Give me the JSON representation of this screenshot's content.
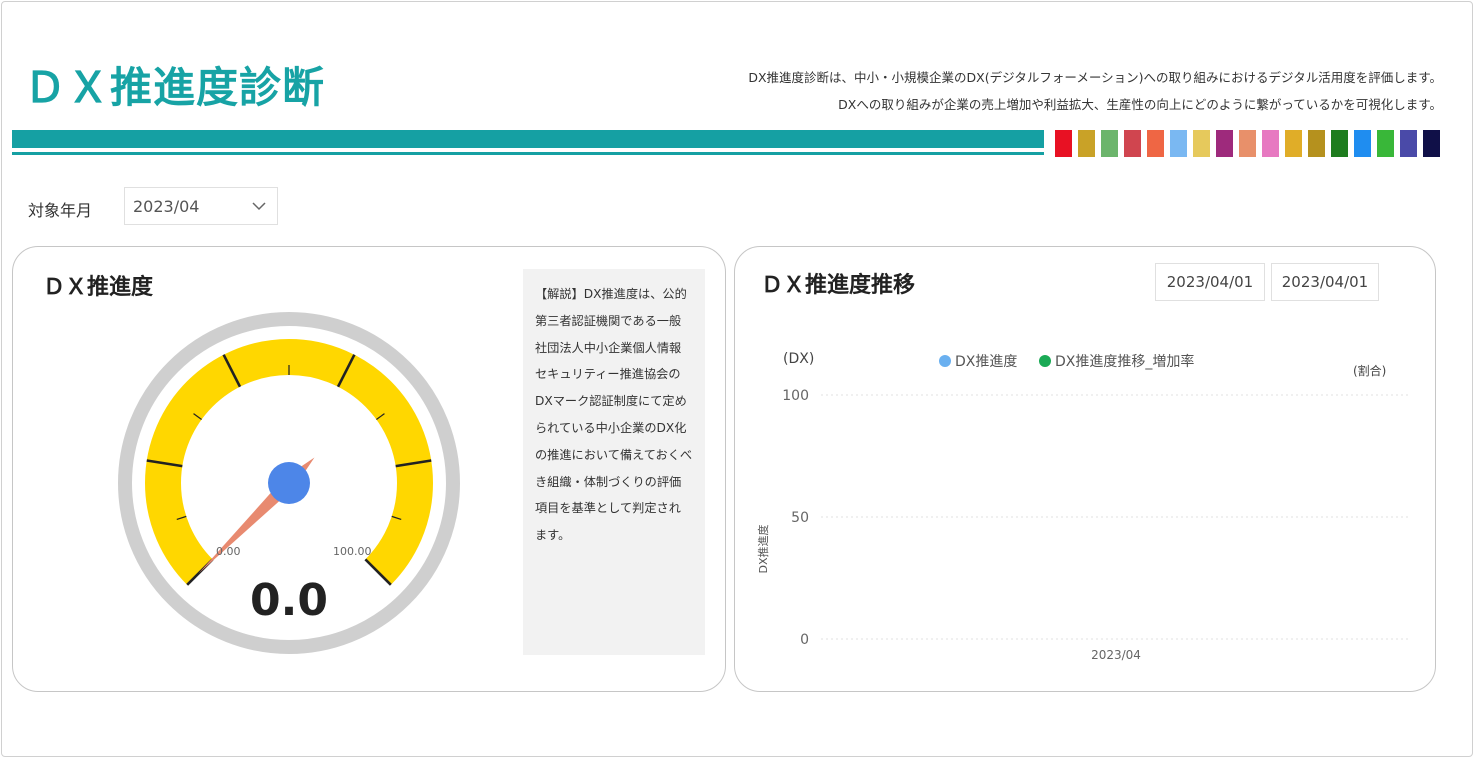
{
  "header": {
    "title": "ＤＸ推進度診断",
    "description_line1": "DX推進度診断は、中小・小規模企業のDX(デジタルフォーメーション)への取り組みにおけるデジタル活用度を評価します。",
    "description_line2": "DXへの取り組みが企業の売上増加や利益拡大、生産性の向上にどのように繋がっているかを可視化します。",
    "accent_color": "#15a0a3",
    "swatch_colors": [
      "#e81123",
      "#c9a227",
      "#6cb56c",
      "#d0454f",
      "#ef6644",
      "#7ab8f2",
      "#e6c95c",
      "#9e2a7c",
      "#e8906a",
      "#e779c1",
      "#e0ad28",
      "#b5911e",
      "#1e7c1e",
      "#1f8df0",
      "#39b739",
      "#4a4aa8",
      "#101048"
    ]
  },
  "filter": {
    "label": "対象年月",
    "value": "2023/04"
  },
  "gauge_card": {
    "title": "ＤＸ推進度",
    "value": "0.0",
    "min_label": "0.00",
    "max_label": "100.00",
    "gauge_value": 0,
    "gauge_min": 0,
    "gauge_max": 100,
    "explanation": "【解説】DX推進度は、公的第三者認証機関である一般社団法人中小企業個人情報セキュリティー推進協会のDXマーク認証制度にて定められている中小企業のDX化の推進において備えておくべき組織・体制づくりの評価項目を基準として判定されます。"
  },
  "trend_card": {
    "title": "ＤＸ推進度推移",
    "date_from": "2023/04/01",
    "date_to": "2023/04/01"
  },
  "chart_data": {
    "type": "line",
    "x": [
      "2023/04"
    ],
    "series": [
      {
        "name": "DX推進度",
        "values": [
          null
        ],
        "color": "#6ab0f0"
      },
      {
        "name": "DX推進度推移_増加率",
        "values": [
          null
        ],
        "color": "#1aaa55"
      }
    ],
    "ylabel": "DX推進度",
    "left_unit": "(DX)",
    "right_unit": "(割合)",
    "yticks": [
      "100",
      "50",
      "0"
    ],
    "ylim": [
      0,
      100
    ],
    "grid": true,
    "legend": "top"
  }
}
